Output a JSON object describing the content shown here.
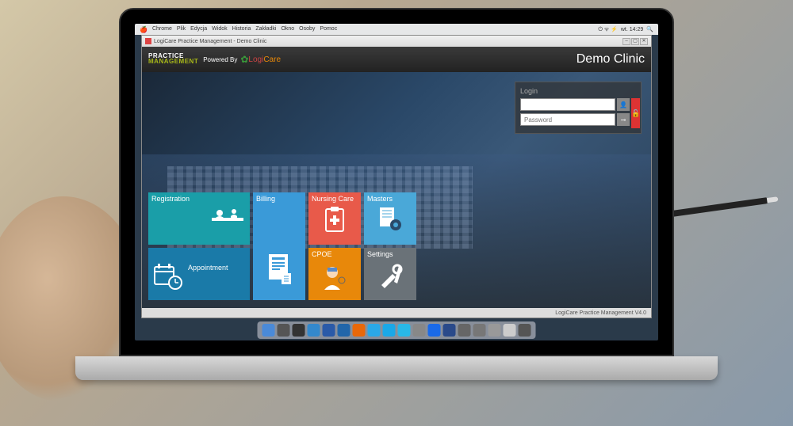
{
  "mac_menu": {
    "items": [
      "Chrome",
      "Plik",
      "Edycja",
      "Widok",
      "Historia",
      "Zakładki",
      "Okno",
      "Osoby",
      "Pomoc"
    ],
    "time": "wt. 14:29"
  },
  "window": {
    "title": "LogiCare Practice Management - Demo Clinic"
  },
  "header": {
    "brand_l1": "PRACTICE",
    "brand_l2": "MANAGEMENT",
    "powered": "Powered By",
    "logo_logi": "Logi",
    "logo_care": "Care",
    "clinic": "Demo Clinic"
  },
  "login": {
    "title": "Login",
    "username_placeholder": "",
    "password_placeholder": "Password"
  },
  "tiles": {
    "registration": "Registration",
    "appointment": "Appointment",
    "billing": "Billing",
    "nursing": "Nursing Care",
    "cpoe": "CPOE",
    "masters": "Masters",
    "settings": "Settings"
  },
  "footer": {
    "version": "LogiCare Practice Management V4.0"
  },
  "dock_colors": [
    "#4a8ad8",
    "#555",
    "#333",
    "#3388cc",
    "#2a5aa8",
    "#26a",
    "#e8680a",
    "#2aa8e8",
    "#1aa8e8",
    "#28b8e8",
    "#888",
    "#1a6ae8",
    "#2a4a8a",
    "#666",
    "#777",
    "#999",
    "#ccc",
    "#555"
  ]
}
